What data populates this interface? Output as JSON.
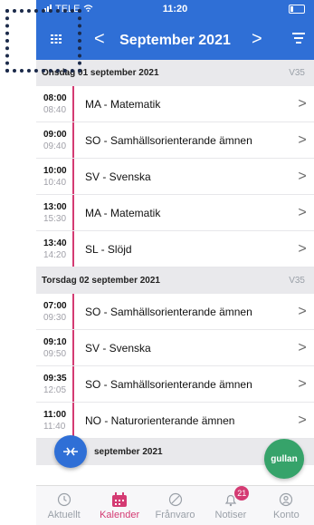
{
  "status": {
    "carrier": "TELE",
    "time": "11:20"
  },
  "header": {
    "title": "September 2021",
    "prev": "<",
    "next": ">"
  },
  "days": [
    {
      "date": "Onsdag 01 september 2021",
      "week": "V35",
      "lessons": [
        {
          "start": "08:00",
          "end": "08:40",
          "subject": "MA - Matematik"
        },
        {
          "start": "09:00",
          "end": "09:40",
          "subject": "SO - Samhällsorienterande ämnen"
        },
        {
          "start": "10:00",
          "end": "10:40",
          "subject": "SV - Svenska"
        },
        {
          "start": "13:00",
          "end": "15:30",
          "subject": "MA - Matematik"
        },
        {
          "start": "13:40",
          "end": "14:20",
          "subject": "SL - Slöjd"
        }
      ]
    },
    {
      "date": "Torsdag 02 september 2021",
      "week": "V35",
      "lessons": [
        {
          "start": "07:00",
          "end": "09:30",
          "subject": "SO - Samhällsorienterande ämnen"
        },
        {
          "start": "09:10",
          "end": "09:50",
          "subject": "SV - Svenska"
        },
        {
          "start": "09:35",
          "end": "12:05",
          "subject": "SO - Samhällsorienterande ämnen"
        },
        {
          "start": "11:00",
          "end": "11:40",
          "subject": "NO - Naturorienterande ämnen"
        }
      ]
    }
  ],
  "partial_day": {
    "date": "september 2021"
  },
  "fab_right_label": "gullan",
  "tabs": [
    {
      "label": "Aktuellt",
      "icon": "clock-icon"
    },
    {
      "label": "Kalender",
      "icon": "calendar-icon",
      "active": true
    },
    {
      "label": "Frånvaro",
      "icon": "absence-icon"
    },
    {
      "label": "Notiser",
      "icon": "bell-icon",
      "badge": "21"
    },
    {
      "label": "Konto",
      "icon": "account-icon"
    }
  ],
  "colors": {
    "primary": "#2f6fd6",
    "accent": "#d43b73",
    "fab_green": "#36a36a"
  }
}
